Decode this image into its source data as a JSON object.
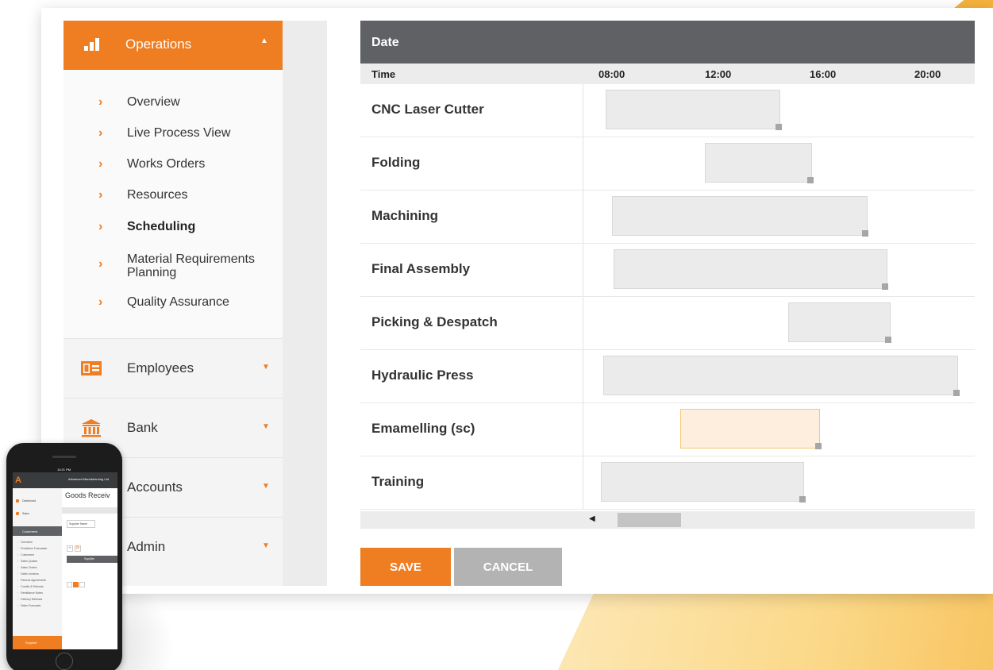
{
  "sidebar": {
    "operations": {
      "label": "Operations",
      "icon": "bar-chart-icon",
      "expanded": true
    },
    "operations_items": [
      {
        "label": "Overview"
      },
      {
        "label": "Live Process View"
      },
      {
        "label": "Works Orders"
      },
      {
        "label": "Resources"
      },
      {
        "label": "Scheduling",
        "active": true
      },
      {
        "label": "Material Requirements Planning"
      },
      {
        "label": "Quality Assurance"
      }
    ],
    "groups": [
      {
        "label": "Employees",
        "icon": "id-card-icon"
      },
      {
        "label": "Bank",
        "icon": "bank-icon"
      },
      {
        "label": "Accounts",
        "icon": "calculator-icon"
      },
      {
        "label": "Admin",
        "icon": "settings-icon"
      }
    ]
  },
  "gantt": {
    "header": "Date",
    "time_label": "Time",
    "times": [
      "08:00",
      "12:00",
      "16:00",
      "20:00"
    ],
    "rows": [
      {
        "label": "CNC Laser Cutter"
      },
      {
        "label": "Folding"
      },
      {
        "label": "Machining"
      },
      {
        "label": "Final Assembly"
      },
      {
        "label": "Picking & Despatch"
      },
      {
        "label": "Hydraulic Press"
      },
      {
        "label": "Emamelling (sc)",
        "highlighted": true
      },
      {
        "label": "Training"
      }
    ]
  },
  "actions": {
    "save": "SAVE",
    "cancel": "CANCEL"
  },
  "phone": {
    "status_time": "10:21 PM",
    "company": "Advanced Manufacturing Ltd",
    "page_title": "Goods Receiv",
    "filter_label": "Supplier Name",
    "menu": [
      "Dashboard",
      "Sales"
    ],
    "section": "Customers",
    "sub_items": [
      "Overview",
      "Prediction Forecaster",
      "Customers",
      "Sales Quotes",
      "Sales Orders",
      "Sales Invoices",
      "Returns Agreements",
      "Credits & Refunds",
      "Remittance Notes",
      "Delivery Methods",
      "Sales Forecasts"
    ],
    "footer": "Supplier",
    "table_col": "Supplier"
  },
  "colors": {
    "accent": "#ef7d22",
    "header_dark": "#5f6164",
    "bar": "#ebebeb",
    "bar_highlight": "#fdeede"
  }
}
